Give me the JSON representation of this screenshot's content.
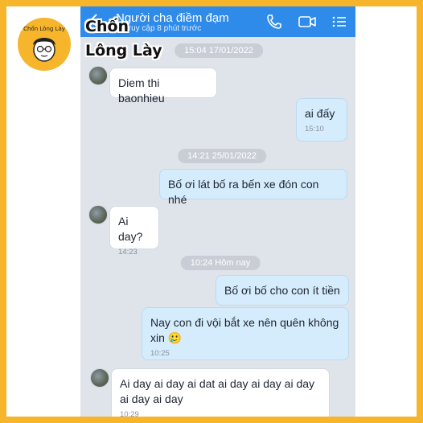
{
  "header": {
    "title": "Người cha điềm đạm",
    "subtitle": "Truy cập 8 phút trước"
  },
  "brand": {
    "line1": "Chốn",
    "line2": "Lông Lày",
    "logo_text": "Chốn Lông Lày"
  },
  "colors": {
    "frame_border": "#f7b52c",
    "header_bg": "#2f8bea",
    "chat_bg": "#dfe3ea",
    "outgoing_bubble": "#d5ecfc",
    "incoming_bubble": "#ffffff"
  },
  "separators": [
    {
      "label": "15:04 17/01/2022"
    },
    {
      "label": "14:21 25/01/2022"
    },
    {
      "label": "10:24 Hôm nay"
    }
  ],
  "messages": [
    {
      "direction": "in",
      "text": "Diem thi baonhieu",
      "time": ""
    },
    {
      "direction": "out",
      "text": "ai đấy",
      "time": "15:10"
    },
    {
      "direction": "out",
      "text": "Bố ơi lát bố ra bến xe đón con nhé",
      "time": ""
    },
    {
      "direction": "in",
      "text": "Ai day?",
      "time": "14:23"
    },
    {
      "direction": "out",
      "text": "Bố ơi bố cho con ít tiền",
      "time": ""
    },
    {
      "direction": "out",
      "text": "Nay con đi vội bắt xe nên quên không xin 🥲",
      "time": "10:25"
    },
    {
      "direction": "in",
      "text": "Ai day ai day ai dat ai day ai day ai day ai day ai day",
      "time": "10:29"
    }
  ],
  "icons": {
    "back": "chevron-left-icon",
    "call": "phone-icon",
    "video": "video-camera-icon",
    "menu": "list-menu-icon"
  }
}
